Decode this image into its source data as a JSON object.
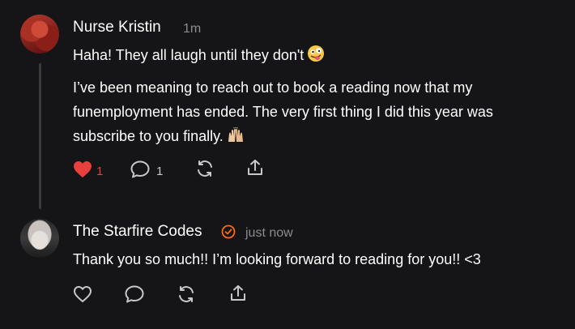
{
  "comment1": {
    "author": "Nurse Kristin",
    "time": "1m",
    "line1": "Haha! They all laugh until they don't",
    "para": [
      "I’ve been meaning to reach out to book a reading now that my",
      "funemployment has ended. The very first thing I did this year was",
      "subscribe to you finally."
    ],
    "likes": "1",
    "replies": "1",
    "like_color": "#e8403d",
    "icons": [
      "heart-filled-icon",
      "comment-icon",
      "restack-icon",
      "share-icon"
    ]
  },
  "comment2": {
    "author": "The Starfire Codes",
    "time": "just now",
    "badge_color": "#ff6719",
    "text": "Thank you so much!! I’m looking forward to reading for you!! <3",
    "icons": [
      "heart-outline-icon",
      "comment-icon",
      "restack-icon",
      "share-icon"
    ]
  }
}
